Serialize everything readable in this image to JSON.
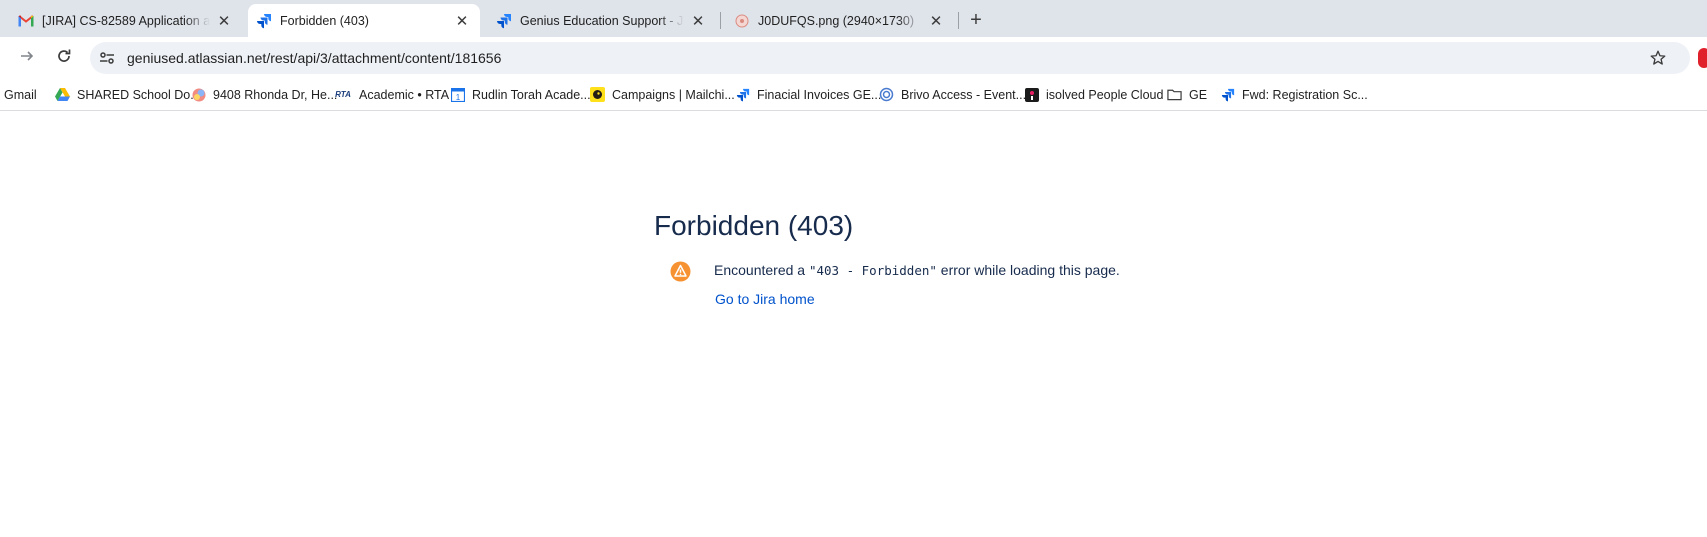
{
  "browser": {
    "tabs": [
      {
        "title": "[JIRA] CS-82589 Application and",
        "icon": "gmail-icon",
        "active": false
      },
      {
        "title": "Forbidden (403)",
        "icon": "jira-icon",
        "active": true
      },
      {
        "title": "Genius Education Support - Jira",
        "icon": "jira-icon",
        "active": false
      },
      {
        "title": "J0DUFQS.png (2940×1730)",
        "icon": "image-icon",
        "active": false
      }
    ],
    "new_tab": "+",
    "url": "geniused.atlassian.net/rest/api/3/attachment/content/181656"
  },
  "bookmarks": [
    {
      "label": "Gmail",
      "icon": ""
    },
    {
      "label": "SHARED School Do...",
      "icon": "google-drive-icon"
    },
    {
      "label": "9408 Rhonda Dr, He...",
      "icon": "colorful-circle-icon"
    },
    {
      "label": "Academic • RTA",
      "icon": "rta-logo-icon"
    },
    {
      "label": "Rudlin Torah Acade...",
      "icon": "calendar-icon"
    },
    {
      "label": "Campaigns | Mailchi...",
      "icon": "mailchimp-icon"
    },
    {
      "label": "Finacial Invoices  GE...",
      "icon": "jira-icon"
    },
    {
      "label": "Brivo Access - Event...",
      "icon": "brivo-icon"
    },
    {
      "label": "isolved People Cloud",
      "icon": "isolved-icon"
    },
    {
      "label": "GE",
      "icon": "folder-icon"
    },
    {
      "label": "Fwd: Registration Sc...",
      "icon": "jira-icon"
    }
  ],
  "page": {
    "title": "Forbidden (403)",
    "message_prefix": "Encountered a ",
    "message_code": "\"403 - Forbidden\"",
    "message_suffix": " error while loading this page.",
    "link": "Go to Jira home"
  },
  "colors": {
    "title": "#172b4d",
    "link": "#0052cc",
    "warning": "#f79232",
    "tabstrip": "#dfe3ea",
    "omnibox": "#eef1f6"
  }
}
